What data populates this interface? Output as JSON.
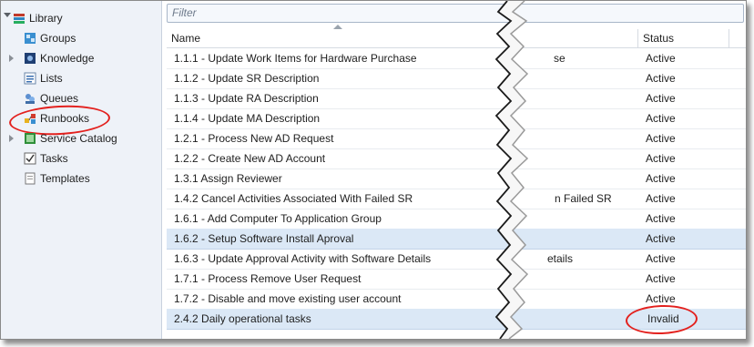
{
  "nav": {
    "library": "Library",
    "items": [
      {
        "label": "Groups",
        "icon": "groups-icon"
      },
      {
        "label": "Knowledge",
        "icon": "knowledge-icon"
      },
      {
        "label": "Lists",
        "icon": "lists-icon"
      },
      {
        "label": "Queues",
        "icon": "queues-icon"
      },
      {
        "label": "Runbooks",
        "icon": "runbooks-icon"
      },
      {
        "label": "Service Catalog",
        "icon": "service-catalog-icon"
      },
      {
        "label": "Tasks",
        "icon": "tasks-icon"
      },
      {
        "label": "Templates",
        "icon": "templates-icon"
      }
    ]
  },
  "filter": {
    "placeholder": "Filter"
  },
  "grid": {
    "columns": {
      "name": "Name",
      "status": "Status"
    },
    "rows": [
      {
        "name": "1.1.1 - Update Work Items for Hardware Purchase",
        "right_fragment": "se",
        "status": "Active"
      },
      {
        "name": "1.1.2 - Update SR Description",
        "right_fragment": "",
        "status": "Active"
      },
      {
        "name": "1.1.3 - Update RA Description",
        "right_fragment": "",
        "status": "Active"
      },
      {
        "name": "1.1.4 - Update MA Description",
        "right_fragment": "",
        "status": "Active"
      },
      {
        "name": "1.2.1 - Process New AD Request",
        "right_fragment": "",
        "status": "Active"
      },
      {
        "name": "1.2.2 - Create New AD Account",
        "right_fragment": "",
        "status": "Active"
      },
      {
        "name": "1.3.1 Assign Reviewer",
        "right_fragment": "",
        "status": "Active"
      },
      {
        "name": "1.4.2 Cancel Activities Associated With Failed SR",
        "right_fragment": "n Failed SR",
        "status": "Active"
      },
      {
        "name": "1.6.1 - Add Computer To Application Group",
        "right_fragment": "",
        "status": "Active"
      },
      {
        "name": "1.6.2 - Setup Software Install Aproval",
        "right_fragment": "",
        "status": "Active"
      },
      {
        "name": "1.6.3 - Update Approval Activity with Software Details",
        "right_fragment": "etails",
        "status": "Active"
      },
      {
        "name": "1.7.1 - Process Remove User Request",
        "right_fragment": "",
        "status": "Active"
      },
      {
        "name": "1.7.2 - Disable and move existing user account",
        "right_fragment": "",
        "status": "Active"
      },
      {
        "name": "2.4.2 Daily operational tasks",
        "right_fragment": "",
        "status": "Invalid"
      }
    ]
  },
  "colors": {
    "highlight_circle": "#e3211e",
    "selected_row": "#dbe8f6"
  }
}
